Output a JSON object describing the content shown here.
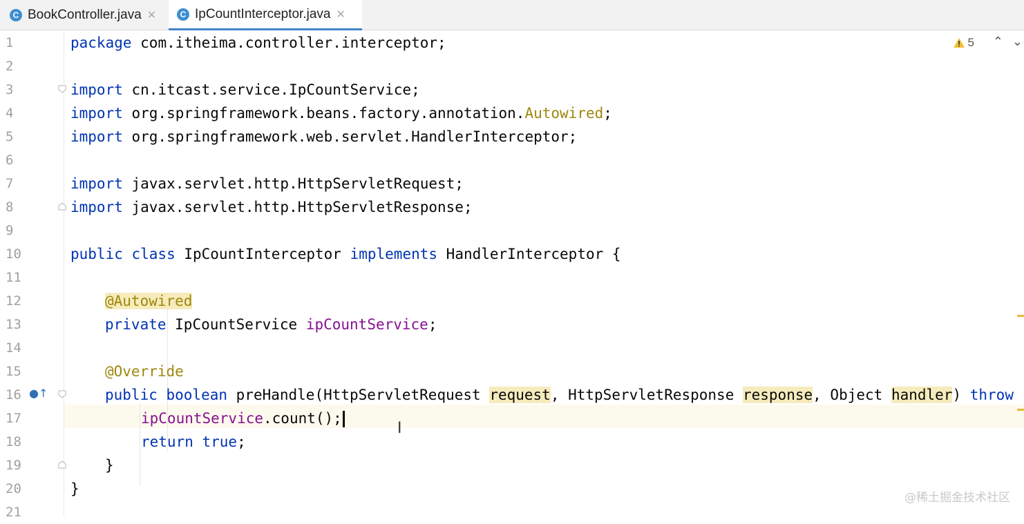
{
  "tabs": [
    {
      "label": "BookController.java",
      "icon": "class-icon",
      "active": false
    },
    {
      "label": "IpCountInterceptor.java",
      "icon": "class-icon",
      "active": true
    }
  ],
  "toolbar": {
    "warnings_count": "5",
    "up_icon": "chevron-up-icon",
    "down_icon": "chevron-down-icon"
  },
  "gutter": {
    "line_numbers": [
      "1",
      "2",
      "3",
      "4",
      "5",
      "6",
      "7",
      "8",
      "9",
      "10",
      "11",
      "12",
      "13",
      "14",
      "15",
      "16",
      "17",
      "18",
      "19",
      "20",
      "21"
    ]
  },
  "code": {
    "l1_kw": "package",
    "l1_rest": " com.itheima.controller.interceptor;",
    "l3_kw": "import",
    "l3_rest": " cn.itcast.service.IpCountService;",
    "l4_kw": "import",
    "l4_rest": " org.springframework.beans.factory.annotation.",
    "l4_ann": "Autowired",
    "l4_end": ";",
    "l5_kw": "import",
    "l5_rest": " org.springframework.web.servlet.HandlerInterceptor;",
    "l7_kw": "import",
    "l7_rest": " javax.servlet.http.HttpServletRequest;",
    "l8_kw": "import",
    "l8_rest": " javax.servlet.http.HttpServletResponse;",
    "l10_kw1": "public class",
    "l10_mid": " IpCountInterceptor ",
    "l10_kw2": "implements",
    "l10_rest": " HandlerInterceptor {",
    "l12_ann": "@Autowired",
    "l13_kw": "private",
    "l13_type": " IpCountService ",
    "l13_field": "ipCountService",
    "l13_end": ";",
    "l15_ann": "@Override",
    "l16_kw": "public boolean",
    "l16_a": " preHandle(HttpServletRequest ",
    "l16_p1": "request",
    "l16_b": ", HttpServletResponse ",
    "l16_p2": "response",
    "l16_c": ", Object ",
    "l16_p3": "handler",
    "l16_d": ") ",
    "l16_kw2": "throw",
    "l17_field": "ipCountService",
    "l17_rest": ".count();",
    "l18_kw": "return true",
    "l18_end": ";",
    "l19": "}",
    "l20": "}"
  },
  "watermark": "@稀土掘金技术社区",
  "colors": {
    "keyword": "#0033b3",
    "annotation": "#9e880d",
    "field": "#871094",
    "highlight": "#f6ebbc",
    "current_line": "#fcfaed",
    "tab_underline": "#4083c9"
  }
}
